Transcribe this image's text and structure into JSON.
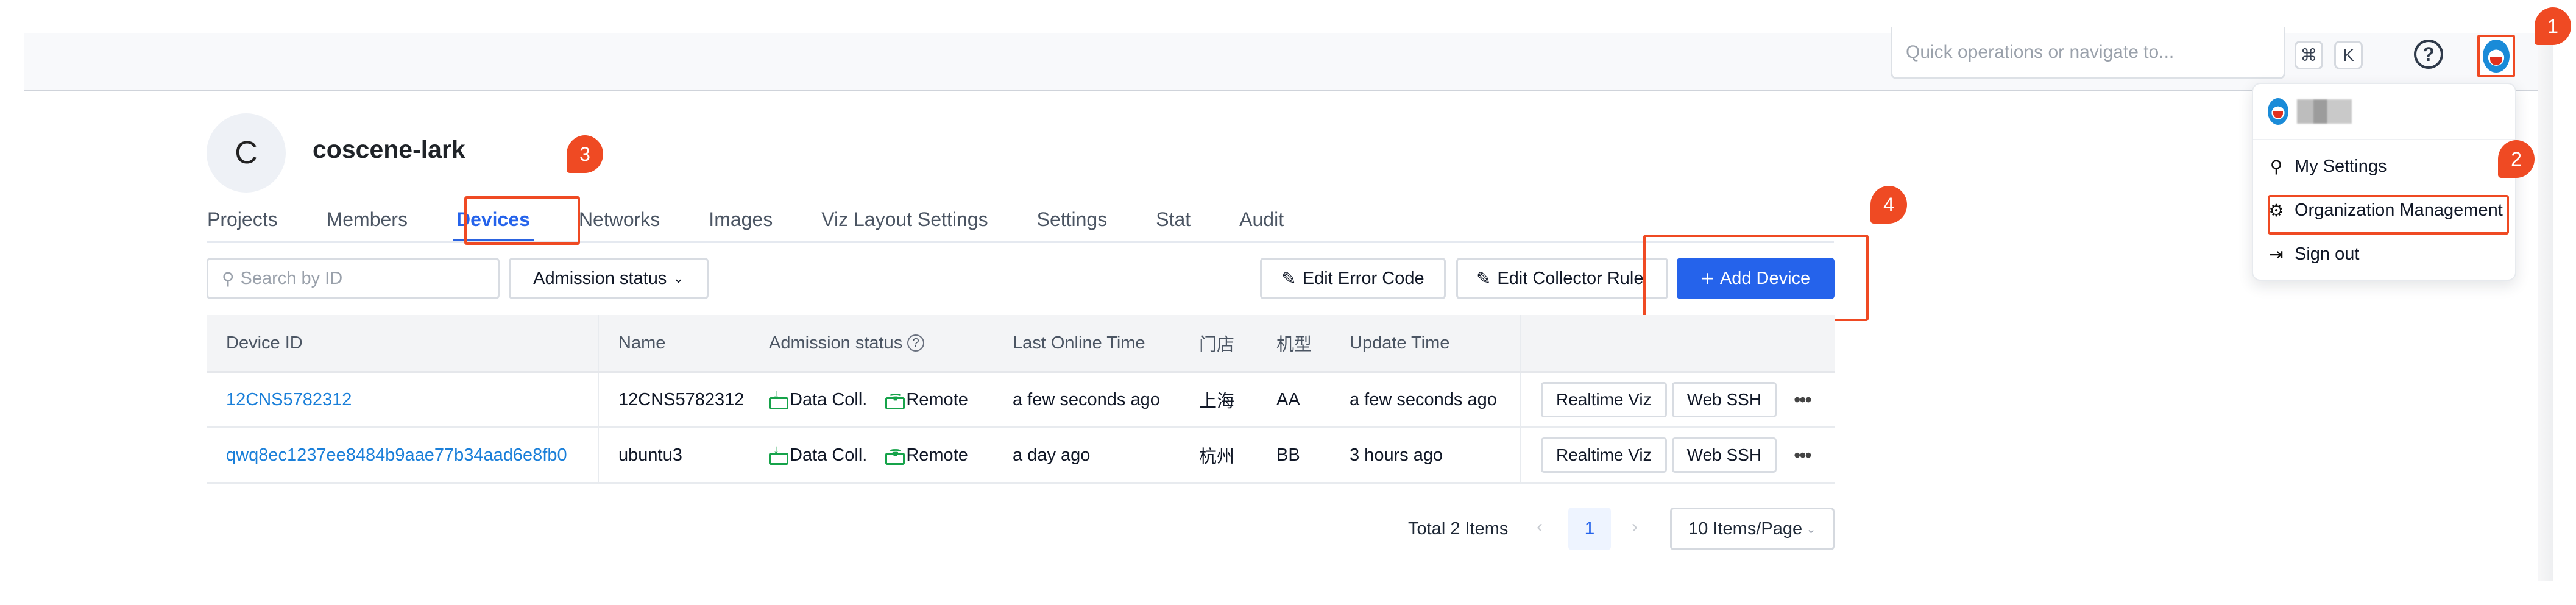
{
  "header": {
    "quick_search_placeholder": "Quick operations or navigate to...",
    "shortcut_keys": [
      "⌘",
      "K"
    ],
    "help_label": "?"
  },
  "user_menu": {
    "items": [
      {
        "label": "My Settings",
        "icon": "user-icon"
      },
      {
        "label": "Organization Management",
        "icon": "gear-icon"
      },
      {
        "label": "Sign out",
        "icon": "sign-out-icon"
      }
    ]
  },
  "annotations": [
    "1",
    "2",
    "3",
    "4"
  ],
  "org": {
    "avatar_letter": "C",
    "name": "coscene-lark"
  },
  "tabs": [
    {
      "label": "Projects",
      "active": false
    },
    {
      "label": "Members",
      "active": false
    },
    {
      "label": "Devices",
      "active": true
    },
    {
      "label": "Networks",
      "active": false
    },
    {
      "label": "Images",
      "active": false
    },
    {
      "label": "Viz Layout Settings",
      "active": false
    },
    {
      "label": "Settings",
      "active": false
    },
    {
      "label": "Stat",
      "active": false
    },
    {
      "label": "Audit",
      "active": false
    }
  ],
  "toolbar": {
    "search_placeholder": "Search by ID",
    "admission_filter": "Admission status",
    "edit_error_code": "Edit Error Code",
    "edit_collector_rule": "Edit Collector Rule",
    "add_device": "Add Device"
  },
  "table": {
    "columns": [
      "Device ID",
      "Name",
      "Admission status",
      "Last Online Time",
      "门店",
      "机型",
      "Update Time"
    ],
    "rows": [
      {
        "device_id": "12CNS5782312",
        "name": "12CNS5782312",
        "status_data": "Data Coll.",
        "status_remote": "Remote",
        "last_online": "a few seconds ago",
        "store": "上海",
        "model": "AA",
        "update_time": "a few seconds ago",
        "actions": [
          "Realtime Viz",
          "Web SSH"
        ]
      },
      {
        "device_id": "qwq8ec1237ee8484b9aae77b34aad6e8fb0",
        "name": "ubuntu3",
        "status_data": "Data Coll.",
        "status_remote": "Remote",
        "last_online": "a day ago",
        "store": "杭州",
        "model": "BB",
        "update_time": "3 hours ago",
        "actions": [
          "Realtime Viz",
          "Web SSH"
        ]
      }
    ]
  },
  "pagination": {
    "total": "Total 2 Items",
    "current_page": "1",
    "page_size": "10 Items/Page"
  },
  "colors": {
    "accent": "#2563eb",
    "link": "#1a7fd9",
    "annotation": "#ef4a23",
    "status_green": "#16a34a"
  }
}
